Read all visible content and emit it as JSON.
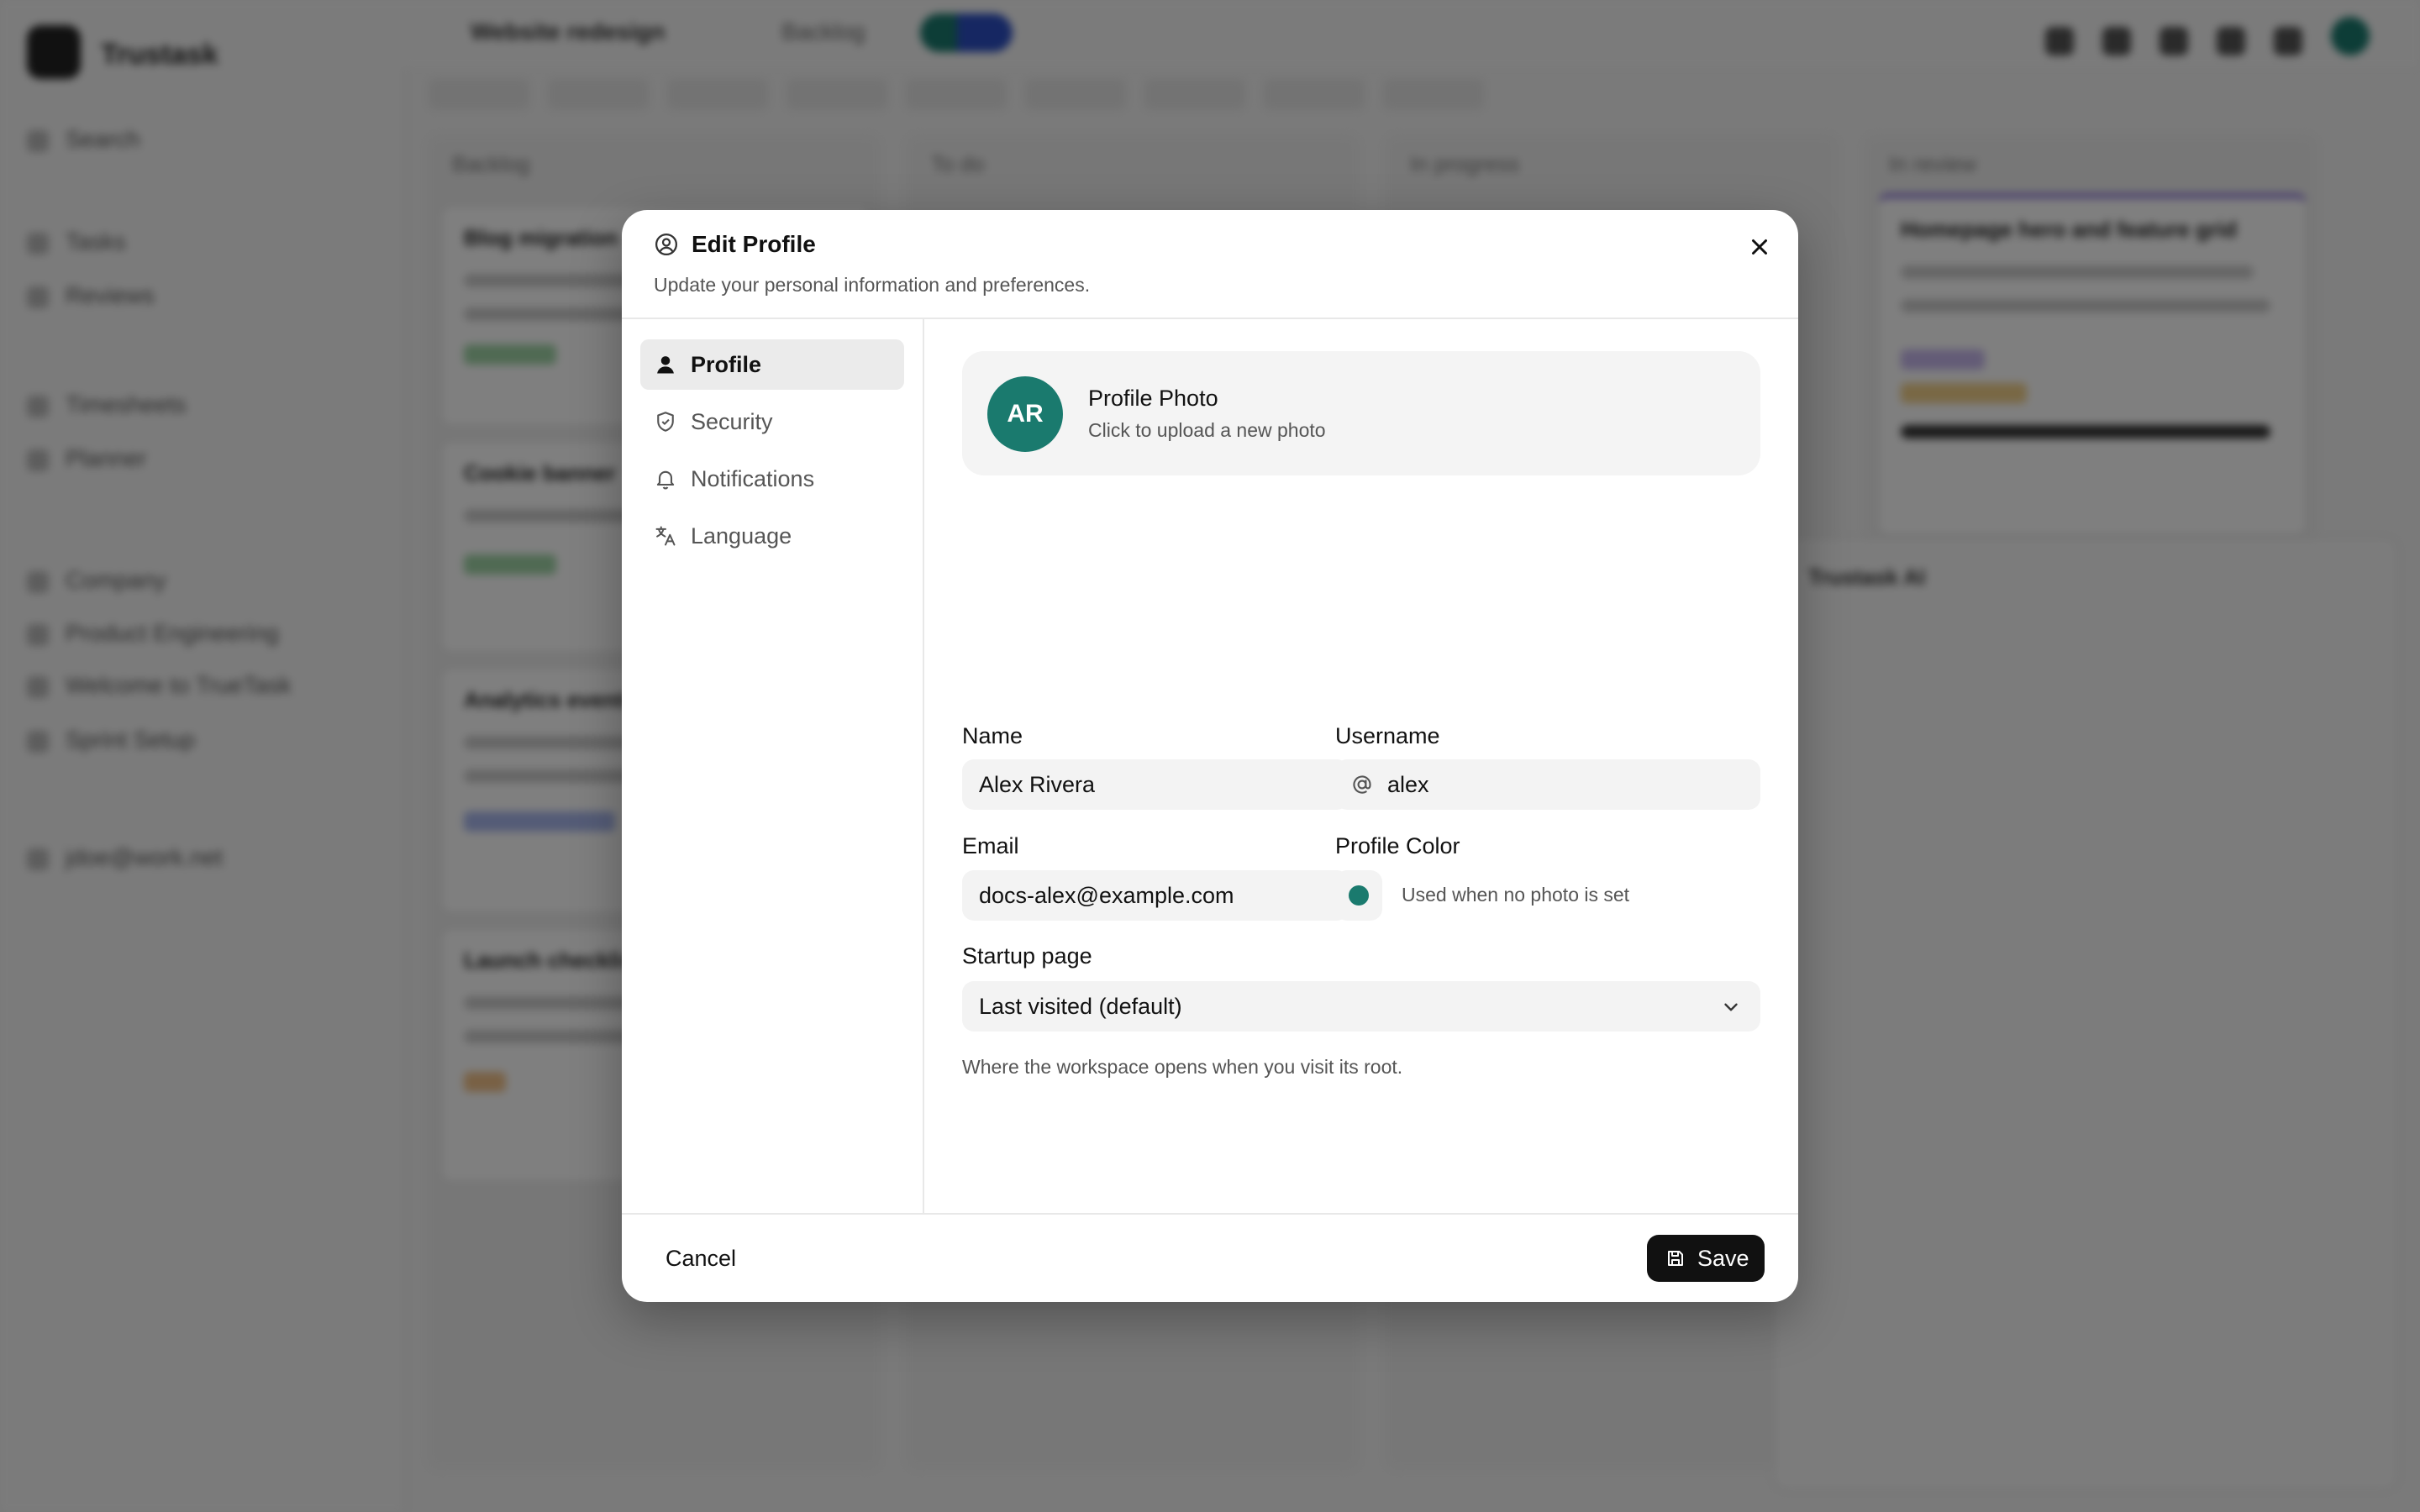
{
  "background": {
    "brand": "Trustask",
    "search_label": "Search",
    "nav": [
      "Tasks",
      "Reviews",
      "Timesheets",
      "Planner",
      "Company",
      "Product Engineering",
      "Welcome to TrueTask",
      "Sprint Setup",
      "jdoe@work.net"
    ],
    "breadcrumb": "Website redesign",
    "breadcrumb_view": "Backlog",
    "columns": [
      "Backlog",
      "To do",
      "In progress",
      "In review"
    ],
    "cards": [
      "Blog migration",
      "Cookie banner",
      "Analytics events",
      "Launch checklist",
      "Homepage hero and feature grid"
    ],
    "ai_panel_title": "Trustask AI"
  },
  "modal": {
    "title": "Edit Profile",
    "subtitle": "Update your personal information and preferences.",
    "nav": [
      {
        "label": "Profile",
        "icon": "user-icon",
        "active": true
      },
      {
        "label": "Security",
        "icon": "shield-icon",
        "active": false
      },
      {
        "label": "Notifications",
        "icon": "bell-icon",
        "active": false
      },
      {
        "label": "Language",
        "icon": "translate-icon",
        "active": false
      }
    ],
    "photo": {
      "initials": "AR",
      "title": "Profile Photo",
      "subtitle": "Click to upload a new photo",
      "color": "#1a7a6e"
    },
    "name": {
      "label": "Name",
      "value": "Alex Rivera"
    },
    "username": {
      "label": "Username",
      "value": "alex"
    },
    "email": {
      "label": "Email",
      "value": "docs-alex@example.com"
    },
    "profile_color": {
      "label": "Profile Color",
      "hint": "Used when no photo is set",
      "value": "#1a7a6e"
    },
    "startup": {
      "label": "Startup page",
      "value": "Last visited (default)",
      "hint": "Where the workspace opens when you visit its root."
    },
    "cancel_label": "Cancel",
    "save_label": "Save"
  }
}
